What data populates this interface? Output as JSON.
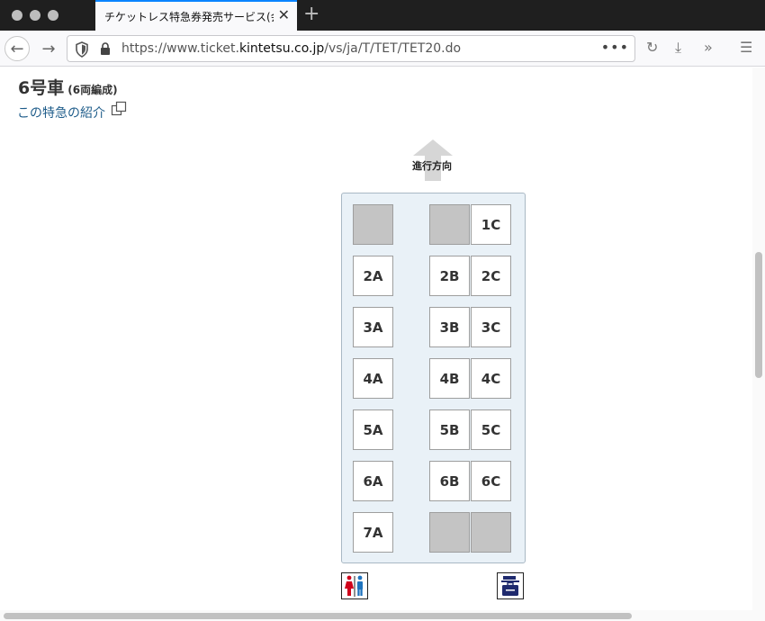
{
  "browser": {
    "tab_title": "チケットレス特急券発売サービス(会員登録",
    "url_prefix": "https://www.ticket.",
    "url_domain": "kintetsu.co.jp",
    "url_path": "/vs/ja/T/TET/TET20.do",
    "url_menu": "•••"
  },
  "page": {
    "car_title": "6号車",
    "car_subtitle": "(6両編成)",
    "intro_link": "この特急の紹介",
    "direction_label": "進行方向"
  },
  "seats": {
    "1C": "1C",
    "2A": "2A",
    "2B": "2B",
    "2C": "2C",
    "3A": "3A",
    "3B": "3B",
    "3C": "3C",
    "4A": "4A",
    "4B": "4B",
    "4C": "4C",
    "5A": "5A",
    "5B": "5B",
    "5C": "5C",
    "6A": "6A",
    "6B": "6B",
    "6C": "6C",
    "7A": "7A"
  },
  "facilities": {
    "left": "restroom-icon",
    "right": "luggage-storage-icon"
  },
  "colors": {
    "accent_tab": "#0a84ff",
    "link": "#1e5c8a",
    "car_bg": "#e9f1f7",
    "unavailable_seat": "#c4c4c4",
    "restroom_female": "#d0021b",
    "restroom_male": "#1e73be",
    "luggage": "#1f2a6e"
  }
}
